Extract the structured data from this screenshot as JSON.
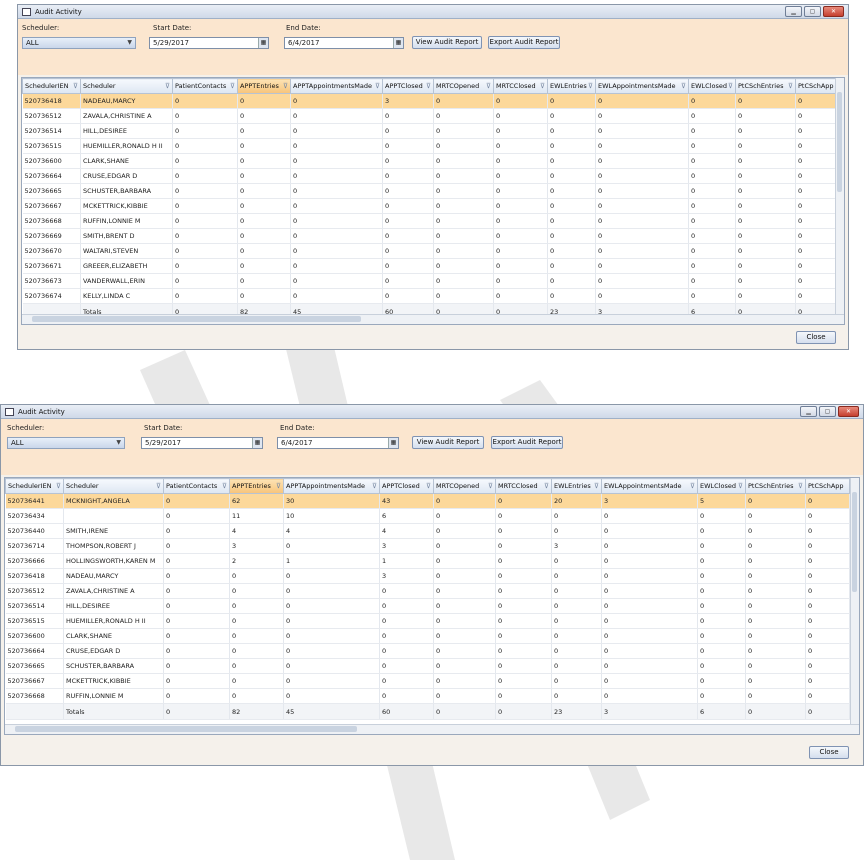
{
  "columns": [
    "SchedulerIEN",
    "Scheduler",
    "PatientContacts",
    "APPTEntries",
    "APPTAppointmentsMade",
    "APPTClosed",
    "MRTCOpened",
    "MRTCClosed",
    "EWLEntries",
    "EWLAppointmentsMade",
    "EWLClosed",
    "PtCSchEntries",
    "PtCSchApp"
  ],
  "window1": {
    "title": "Audit Activity",
    "scheduler_label": "Scheduler:",
    "scheduler_value": "ALL",
    "start_label": "Start Date:",
    "start_value": "5/29/2017",
    "end_label": "End Date:",
    "end_value": "6/4/2017",
    "view_button": "View Audit Report",
    "export_button": "Export Audit Report",
    "close_button": "Close",
    "rows": [
      [
        "520736418",
        "NADEAU,MARCY",
        "0",
        "0",
        "0",
        "3",
        "0",
        "0",
        "0",
        "0",
        "0",
        "0",
        "0"
      ],
      [
        "520736512",
        "ZAVALA,CHRISTINE A",
        "0",
        "0",
        "0",
        "0",
        "0",
        "0",
        "0",
        "0",
        "0",
        "0",
        "0"
      ],
      [
        "520736514",
        "HILL,DESIREE",
        "0",
        "0",
        "0",
        "0",
        "0",
        "0",
        "0",
        "0",
        "0",
        "0",
        "0"
      ],
      [
        "520736515",
        "HUEMILLER,RONALD H II",
        "0",
        "0",
        "0",
        "0",
        "0",
        "0",
        "0",
        "0",
        "0",
        "0",
        "0"
      ],
      [
        "520736600",
        "CLARK,SHANE",
        "0",
        "0",
        "0",
        "0",
        "0",
        "0",
        "0",
        "0",
        "0",
        "0",
        "0"
      ],
      [
        "520736664",
        "CRUSE,EDGAR D",
        "0",
        "0",
        "0",
        "0",
        "0",
        "0",
        "0",
        "0",
        "0",
        "0",
        "0"
      ],
      [
        "520736665",
        "SCHUSTER,BARBARA",
        "0",
        "0",
        "0",
        "0",
        "0",
        "0",
        "0",
        "0",
        "0",
        "0",
        "0"
      ],
      [
        "520736667",
        "MCKETTRICK,KIBBIE",
        "0",
        "0",
        "0",
        "0",
        "0",
        "0",
        "0",
        "0",
        "0",
        "0",
        "0"
      ],
      [
        "520736668",
        "RUFFIN,LONNIE M",
        "0",
        "0",
        "0",
        "0",
        "0",
        "0",
        "0",
        "0",
        "0",
        "0",
        "0"
      ],
      [
        "520736669",
        "SMITH,BRENT D",
        "0",
        "0",
        "0",
        "0",
        "0",
        "0",
        "0",
        "0",
        "0",
        "0",
        "0"
      ],
      [
        "520736670",
        "WALTARI,STEVEN",
        "0",
        "0",
        "0",
        "0",
        "0",
        "0",
        "0",
        "0",
        "0",
        "0",
        "0"
      ],
      [
        "520736671",
        "GREEER,ELIZABETH",
        "0",
        "0",
        "0",
        "0",
        "0",
        "0",
        "0",
        "0",
        "0",
        "0",
        "0"
      ],
      [
        "520736673",
        "VANDERWALL,ERIN",
        "0",
        "0",
        "0",
        "0",
        "0",
        "0",
        "0",
        "0",
        "0",
        "0",
        "0"
      ],
      [
        "520736674",
        "KELLY,LINDA C",
        "0",
        "0",
        "0",
        "0",
        "0",
        "0",
        "0",
        "0",
        "0",
        "0",
        "0"
      ]
    ],
    "totals": [
      "",
      "Totals",
      "0",
      "82",
      "45",
      "60",
      "0",
      "0",
      "23",
      "3",
      "6",
      "0",
      "0"
    ]
  },
  "window2": {
    "title": "Audit Activity",
    "scheduler_label": "Scheduler:",
    "scheduler_value": "ALL",
    "start_label": "Start Date:",
    "start_value": "5/29/2017",
    "end_label": "End Date:",
    "end_value": "6/4/2017",
    "view_button": "View Audit Report",
    "export_button": "Export Audit Report",
    "close_button": "Close",
    "rows": [
      [
        "520736441",
        "MCKNIGHT,ANGELA",
        "0",
        "62",
        "30",
        "43",
        "0",
        "0",
        "20",
        "3",
        "5",
        "0",
        "0"
      ],
      [
        "520736434",
        "",
        "0",
        "11",
        "10",
        "6",
        "0",
        "0",
        "0",
        "0",
        "0",
        "0",
        "0"
      ],
      [
        "520736440",
        "SMITH,IRENE",
        "0",
        "4",
        "4",
        "4",
        "0",
        "0",
        "0",
        "0",
        "0",
        "0",
        "0"
      ],
      [
        "520736714",
        "THOMPSON,ROBERT J",
        "0",
        "3",
        "0",
        "3",
        "0",
        "0",
        "3",
        "0",
        "0",
        "0",
        "0"
      ],
      [
        "520736666",
        "HOLLINGSWORTH,KAREN M",
        "0",
        "2",
        "1",
        "1",
        "0",
        "0",
        "0",
        "0",
        "0",
        "0",
        "0"
      ],
      [
        "520736418",
        "NADEAU,MARCY",
        "0",
        "0",
        "0",
        "3",
        "0",
        "0",
        "0",
        "0",
        "0",
        "0",
        "0"
      ],
      [
        "520736512",
        "ZAVALA,CHRISTINE A",
        "0",
        "0",
        "0",
        "0",
        "0",
        "0",
        "0",
        "0",
        "0",
        "0",
        "0"
      ],
      [
        "520736514",
        "HILL,DESIREE",
        "0",
        "0",
        "0",
        "0",
        "0",
        "0",
        "0",
        "0",
        "0",
        "0",
        "0"
      ],
      [
        "520736515",
        "HUEMILLER,RONALD H II",
        "0",
        "0",
        "0",
        "0",
        "0",
        "0",
        "0",
        "0",
        "0",
        "0",
        "0"
      ],
      [
        "520736600",
        "CLARK,SHANE",
        "0",
        "0",
        "0",
        "0",
        "0",
        "0",
        "0",
        "0",
        "0",
        "0",
        "0"
      ],
      [
        "520736664",
        "CRUSE,EDGAR D",
        "0",
        "0",
        "0",
        "0",
        "0",
        "0",
        "0",
        "0",
        "0",
        "0",
        "0"
      ],
      [
        "520736665",
        "SCHUSTER,BARBARA",
        "0",
        "0",
        "0",
        "0",
        "0",
        "0",
        "0",
        "0",
        "0",
        "0",
        "0"
      ],
      [
        "520736667",
        "MCKETTRICK,KIBBIE",
        "0",
        "0",
        "0",
        "0",
        "0",
        "0",
        "0",
        "0",
        "0",
        "0",
        "0"
      ],
      [
        "520736668",
        "RUFFIN,LONNIE M",
        "0",
        "0",
        "0",
        "0",
        "0",
        "0",
        "0",
        "0",
        "0",
        "0",
        "0"
      ]
    ],
    "totals": [
      "",
      "Totals",
      "0",
      "82",
      "45",
      "60",
      "0",
      "0",
      "23",
      "3",
      "6",
      "0",
      "0"
    ]
  },
  "icons": {
    "filter": "filter-icon",
    "calendar": "calendar-icon",
    "dropdown": "chevron-down-icon"
  }
}
